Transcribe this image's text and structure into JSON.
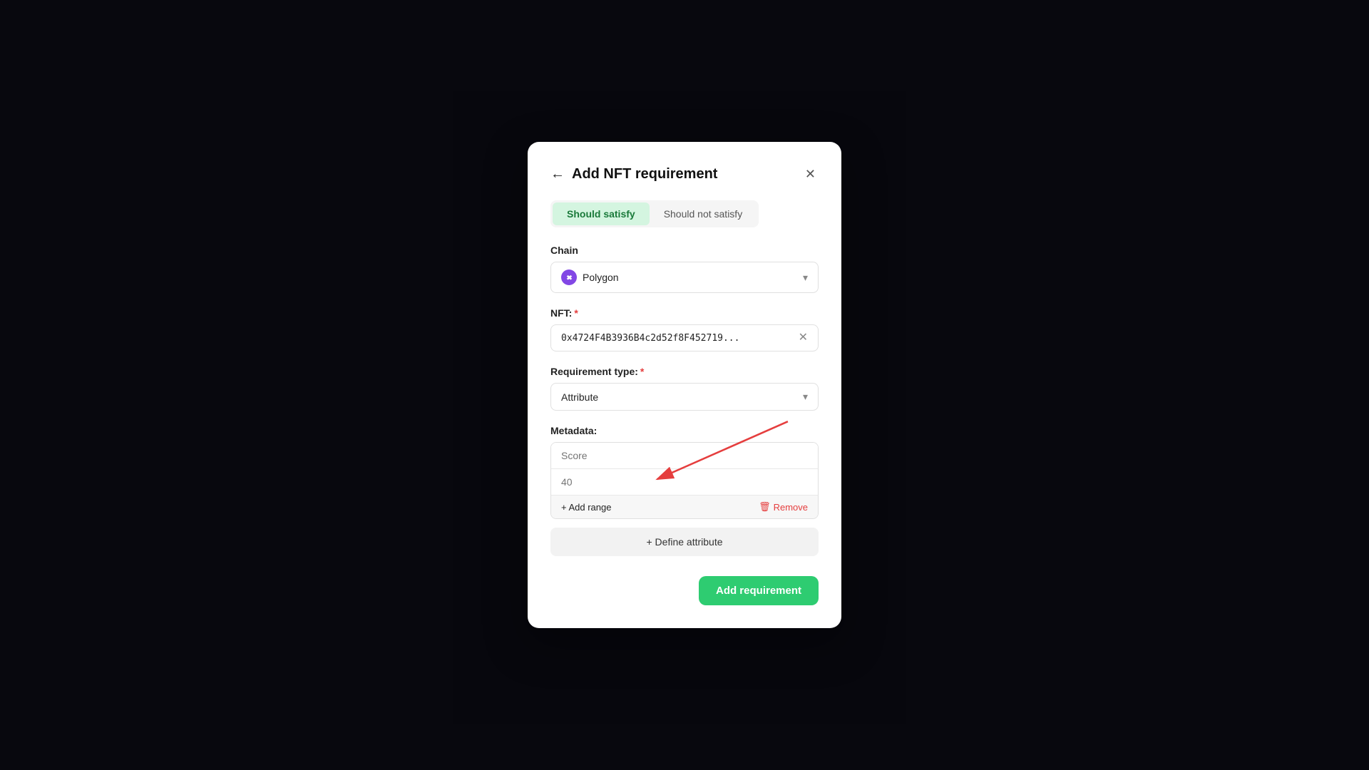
{
  "modal": {
    "title": "Add NFT requirement",
    "back_label": "←",
    "close_label": "✕"
  },
  "toggle": {
    "should_satisfy": "Should satisfy",
    "should_not_satisfy": "Should not satisfy"
  },
  "chain": {
    "label": "Chain",
    "value": "Polygon",
    "icon": "polygon-icon"
  },
  "nft": {
    "label": "NFT:",
    "value": "0x4724F4B3936B4c2d52f8F452719...",
    "clear_label": "✕"
  },
  "requirement_type": {
    "label": "Requirement type:",
    "value": "Attribute"
  },
  "metadata": {
    "label": "Metadata:",
    "score_placeholder": "Score",
    "value_placeholder": "40",
    "add_range_label": "+ Add range",
    "remove_label": "Remove"
  },
  "define_attribute": {
    "label": "+ Define attribute"
  },
  "footer": {
    "add_button": "Add requirement"
  }
}
